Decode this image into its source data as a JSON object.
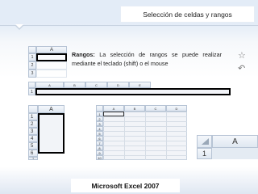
{
  "slide": {
    "title": "Selección de celdas y rangos",
    "body_label": "Rangos:",
    "body_text": " La selección de rangos se puede realizar mediante el teclado (shift) o el mouse",
    "footer": "Microsoft Excel 2007"
  },
  "sheet_top_left": {
    "col_header": "A",
    "rows": [
      "1",
      "2",
      "3"
    ]
  },
  "sheet_row_wide": {
    "cols": [
      "A",
      "B",
      "C",
      "D",
      "E"
    ],
    "rows": [
      "1"
    ]
  },
  "sheet_column_zoom": {
    "col_header": "A",
    "rows": [
      "1",
      "2",
      "3",
      "4",
      "5",
      "6",
      "7"
    ]
  },
  "sheet_grid": {
    "cols": [
      "A",
      "B",
      "C",
      "D"
    ],
    "rows": [
      "1",
      "2",
      "3",
      "4",
      "5",
      "6",
      "7",
      "8",
      "9",
      "10"
    ]
  },
  "sheet_corner": {
    "col_header": "A",
    "rows": [
      "1"
    ]
  },
  "icons": {
    "star": "☆",
    "undo": "↶"
  }
}
